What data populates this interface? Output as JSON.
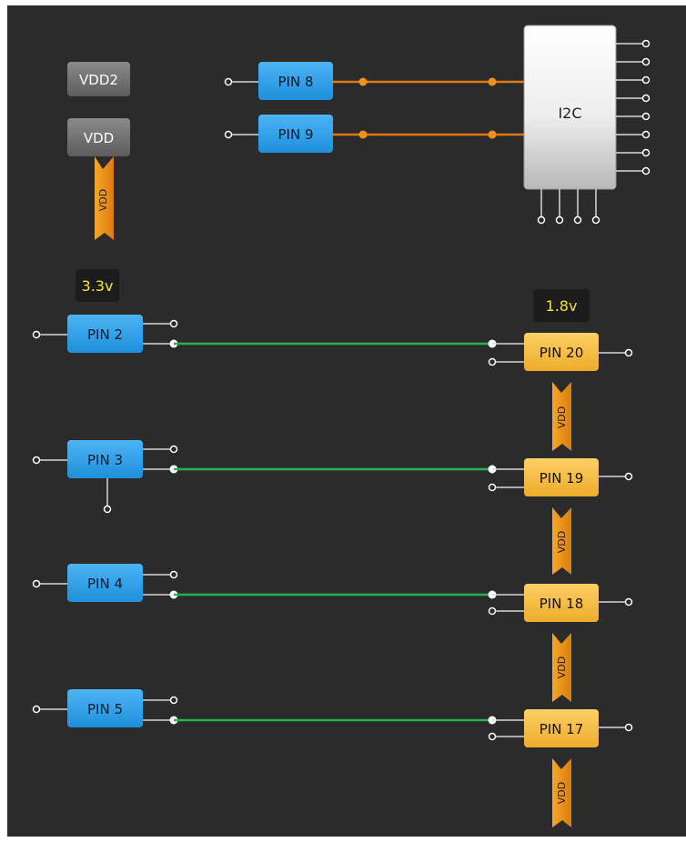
{
  "power": {
    "vdd2_label": "VDD2",
    "vdd_label": "VDD",
    "vdd_rail_label": "VDD"
  },
  "i2c_block": {
    "label": "I2C",
    "inputs": [
      {
        "pin": "PIN 8"
      },
      {
        "pin": "PIN 9"
      }
    ]
  },
  "voltages": {
    "left_bank": "3.3v",
    "right_bank": "1.8v"
  },
  "left_pins": [
    {
      "label": "PIN 2"
    },
    {
      "label": "PIN 3"
    },
    {
      "label": "PIN 4"
    },
    {
      "label": "PIN 5"
    }
  ],
  "right_pins": [
    {
      "label": "PIN 20",
      "rail": "VDD"
    },
    {
      "label": "PIN 19",
      "rail": "VDD"
    },
    {
      "label": "PIN 18",
      "rail": "VDD"
    },
    {
      "label": "PIN 17",
      "rail": "VDD"
    }
  ],
  "colors": {
    "background": "#2b2b2b",
    "io_pin_blue": "#2f9ee6",
    "pin_yellow": "#f2b83a",
    "vdd_orange": "#f29a1f",
    "wire_orange": "#e07a12",
    "wire_green": "#26b34a",
    "block_gray": "#6e6e6e",
    "voltage_text": "#f5e51a"
  }
}
